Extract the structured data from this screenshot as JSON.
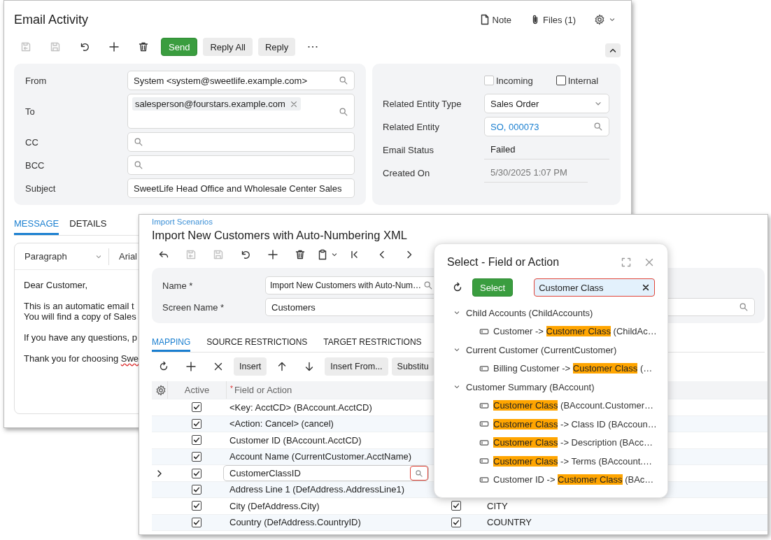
{
  "email": {
    "title": "Email Activity",
    "header_links": [
      {
        "kind": "note",
        "label": "Note"
      },
      {
        "kind": "files",
        "label": "Files (1)"
      }
    ],
    "toolbar": [
      {
        "kind": "save-close",
        "disabled": true
      },
      {
        "kind": "save",
        "disabled": true
      },
      {
        "kind": "undo",
        "disabled": false
      },
      {
        "kind": "add",
        "disabled": false
      },
      {
        "kind": "delete",
        "disabled": false
      },
      {
        "kind": "button",
        "label": "Send",
        "primary": true
      },
      {
        "kind": "button",
        "label": "Reply All",
        "primary": false
      },
      {
        "kind": "button",
        "label": "Reply",
        "primary": false
      },
      {
        "kind": "more",
        "disabled": false
      }
    ],
    "fields": [
      {
        "label": "From",
        "kind": "lookup",
        "value": "System <system@sweetlife.example.com>"
      },
      {
        "label": "To",
        "kind": "tags",
        "tags": [
          "salesperson@fourstars.example.com"
        ]
      },
      {
        "label": "CC",
        "kind": "lookup"
      },
      {
        "label": "BCC",
        "kind": "lookup"
      },
      {
        "label": "Subject",
        "kind": "text",
        "value": "SweetLife Head Office and Wholesale Center Sales"
      }
    ],
    "flags": [
      {
        "label": "Incoming",
        "checked": false,
        "disabled": true
      },
      {
        "label": "Internal",
        "checked": false,
        "disabled": false
      }
    ],
    "details": [
      {
        "label": "Related Entity Type",
        "kind": "select",
        "value": "Sales Order"
      },
      {
        "label": "Related Entity",
        "kind": "link-lookup",
        "value": "SO, 000073"
      },
      {
        "label": "Email Status",
        "kind": "readonly",
        "value": "Failed"
      },
      {
        "label": "Created On",
        "kind": "disabled",
        "value": "5/30/2025 1:07 PM"
      }
    ],
    "tabs": [
      {
        "label": "MESSAGE",
        "selected": true
      },
      {
        "label": "DETAILS",
        "selected": false
      }
    ],
    "editor": {
      "format": "Paragraph",
      "font": "Arial",
      "paragraphs": [
        {
          "lines": [
            {
              "segments": [
                {
                  "text": "Dear Customer,",
                  "misspelled": false
                }
              ]
            }
          ]
        },
        {
          "lines": [
            {
              "segments": [
                {
                  "text": "This is an automatic email t",
                  "misspelled": false
                }
              ]
            },
            {
              "segments": [
                {
                  "text": "You will find a copy of Sales",
                  "misspelled": false
                }
              ]
            }
          ]
        },
        {
          "lines": [
            {
              "segments": [
                {
                  "text": "If you have any questions, p",
                  "misspelled": false
                }
              ]
            }
          ]
        },
        {
          "lines": [
            {
              "segments": [
                {
                  "text": "Thank you for choosing ",
                  "misspelled": false
                },
                {
                  "text": "Swe",
                  "misspelled": true
                }
              ]
            }
          ]
        }
      ]
    }
  },
  "import": {
    "breadcrumb": "Import Scenarios",
    "title": "Import New Customers with Auto-Numbering XML",
    "toolbar": [
      {
        "kind": "back",
        "disabled": false
      },
      {
        "kind": "save-close",
        "disabled": true
      },
      {
        "kind": "save",
        "disabled": true
      },
      {
        "kind": "undo",
        "disabled": false
      },
      {
        "kind": "add",
        "disabled": false
      },
      {
        "kind": "delete",
        "disabled": false
      },
      {
        "kind": "clipboard",
        "disabled": false
      },
      {
        "kind": "first",
        "disabled": false
      },
      {
        "kind": "prev",
        "disabled": false
      },
      {
        "kind": "next",
        "disabled": false
      }
    ],
    "fields": [
      {
        "label": "Name *",
        "value": "Import New Customers with Auto-Num…",
        "kind": "short"
      },
      {
        "label": "Screen Name *",
        "value": "Customers",
        "kind": "wide"
      }
    ],
    "tabs": [
      {
        "label": "MAPPING",
        "selected": true
      },
      {
        "label": "SOURCE RESTRICTIONS",
        "selected": false
      },
      {
        "label": "TARGET RESTRICTIONS",
        "selected": false
      }
    ],
    "grid_toolbar": [
      {
        "kind": "refresh"
      },
      {
        "kind": "add"
      },
      {
        "kind": "remove"
      },
      {
        "kind": "button",
        "label": "Insert"
      },
      {
        "kind": "up"
      },
      {
        "kind": "down"
      },
      {
        "kind": "button",
        "label": "Insert From..."
      },
      {
        "kind": "button",
        "label": "Substitu"
      }
    ],
    "grid": {
      "columns": [
        {
          "label": "Active"
        },
        {
          "label": "Field or Action",
          "marker": "*"
        }
      ],
      "rows": [
        {
          "selected": false,
          "active": true,
          "editing": false,
          "field": "<Key: AcctCD> (BAccount.AcctCD)"
        },
        {
          "selected": false,
          "active": true,
          "editing": false,
          "field": "<Action: Cancel> (cancel)"
        },
        {
          "selected": false,
          "active": true,
          "editing": false,
          "field": "Customer ID (BAccount.AcctCD)"
        },
        {
          "selected": false,
          "active": true,
          "editing": false,
          "field": "Account Name (CurrentCustomer.AcctName)"
        },
        {
          "selected": true,
          "active": true,
          "editing": true,
          "field": "CustomerClassID"
        },
        {
          "selected": false,
          "active": true,
          "editing": false,
          "field": "Address Line 1 (DefAddress.AddressLine1)"
        },
        {
          "selected": false,
          "active": true,
          "editing": false,
          "field": "City (DefAddress.City)",
          "column_3": {
            "checked": true
          },
          "column_4": "CITY"
        },
        {
          "selected": false,
          "active": true,
          "editing": false,
          "field": "Country (DefAddress.CountryID)",
          "column_3": {
            "checked": true
          },
          "column_4": "COUNTRY"
        }
      ]
    }
  },
  "popup": {
    "title": "Select - Field or Action",
    "button": "Select",
    "search": "Customer Class",
    "tree": [
      {
        "label": "Child Accounts (ChildAccounts)",
        "expanded": true,
        "children": [
          {
            "segments": [
              {
                "text": "Customer -> ",
                "highlight": false
              },
              {
                "text": "Customer Class",
                "highlight": true
              },
              {
                "text": " (ChildAc…",
                "highlight": false
              }
            ]
          }
        ]
      },
      {
        "label": "Current Customer (CurrentCustomer)",
        "expanded": true,
        "children": [
          {
            "segments": [
              {
                "text": "Billing Customer -> ",
                "highlight": false
              },
              {
                "text": "Customer Class",
                "highlight": true
              },
              {
                "text": " (…",
                "highlight": false
              }
            ]
          }
        ]
      },
      {
        "label": "Customer Summary (BAccount)",
        "expanded": true,
        "children": [
          {
            "segments": [
              {
                "text": "Customer Class",
                "highlight": true
              },
              {
                "text": " (BAccount.Customer…",
                "highlight": false
              }
            ]
          },
          {
            "segments": [
              {
                "text": "Customer Class",
                "highlight": true
              },
              {
                "text": " -> Class ID (BAccoun…",
                "highlight": false
              }
            ]
          },
          {
            "segments": [
              {
                "text": "Customer Class",
                "highlight": true
              },
              {
                "text": " -> Description (BAcc…",
                "highlight": false
              }
            ]
          },
          {
            "segments": [
              {
                "text": "Customer Class",
                "highlight": true
              },
              {
                "text": " -> Terms (BAccount.…",
                "highlight": false
              }
            ]
          },
          {
            "segments": [
              {
                "text": "Customer ID -> ",
                "highlight": false
              },
              {
                "text": "Customer Class",
                "highlight": true
              },
              {
                "text": " (BAc…",
                "highlight": false
              }
            ]
          }
        ]
      }
    ]
  }
}
